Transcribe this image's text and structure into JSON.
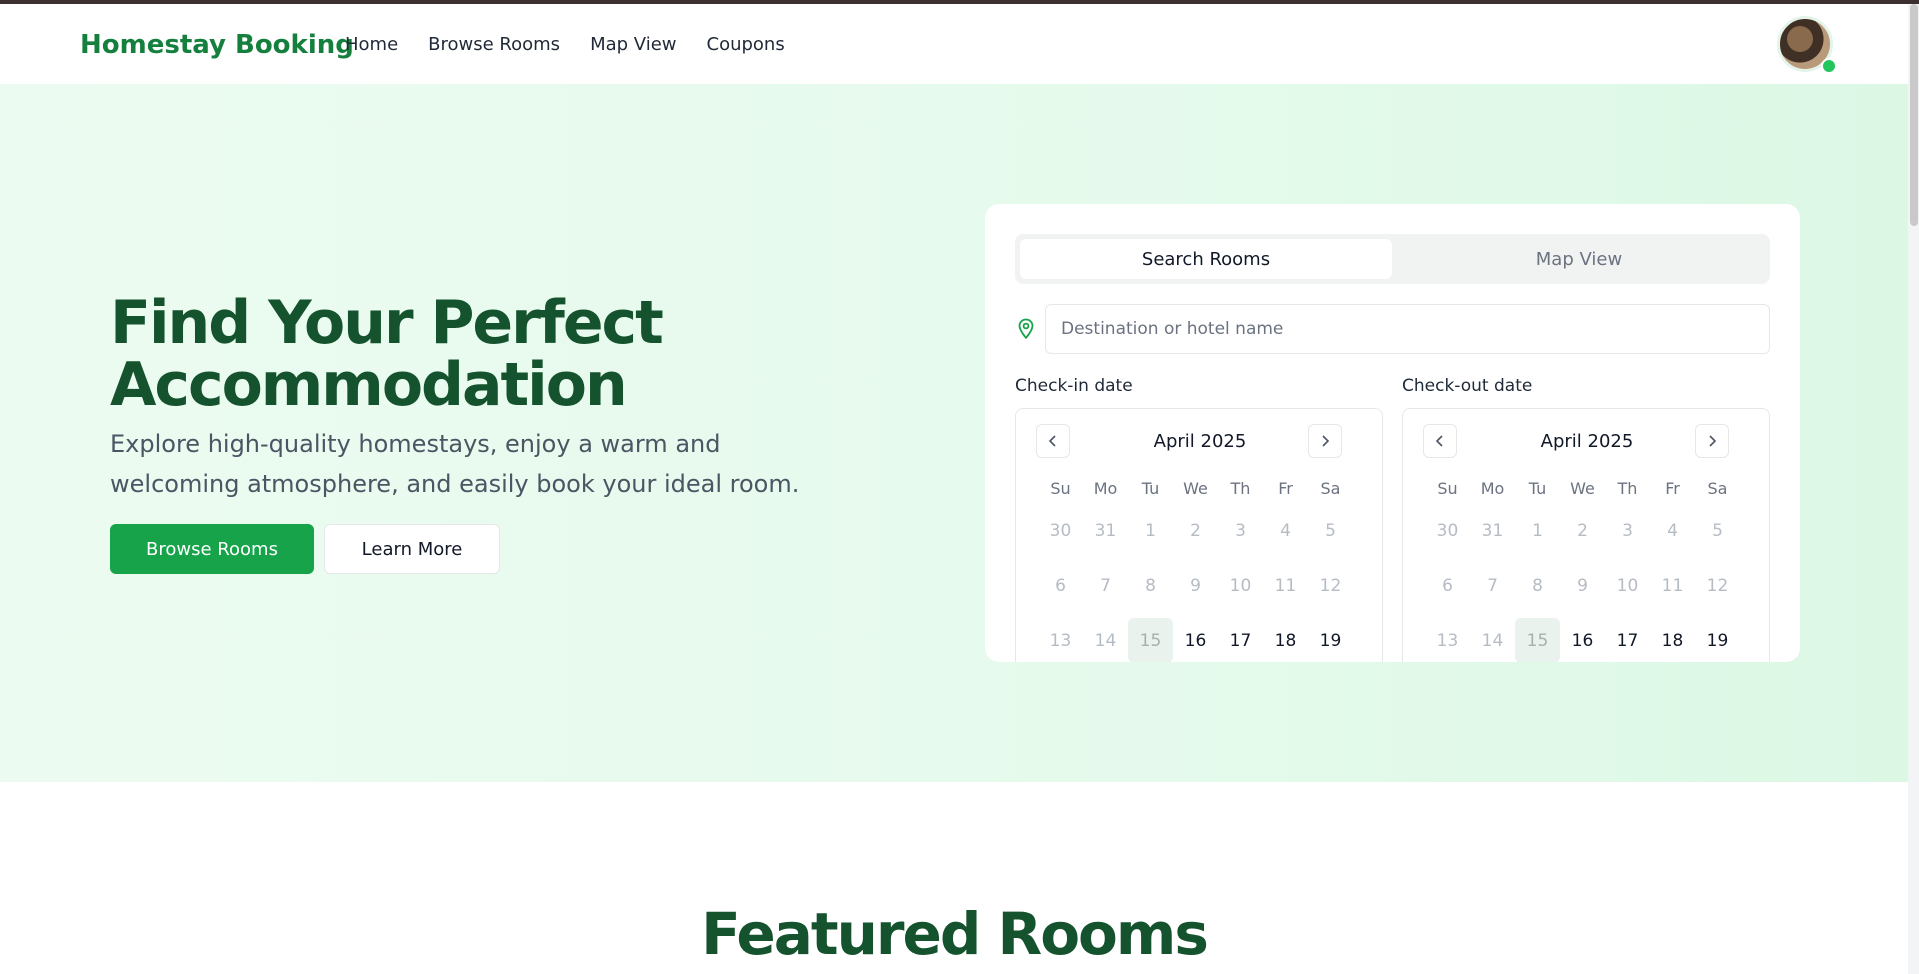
{
  "header": {
    "brand": "Homestay Booking",
    "nav": [
      "Home",
      "Browse Rooms",
      "Map View",
      "Coupons"
    ],
    "status_color": "#22c55e"
  },
  "hero": {
    "title_line1": "Find Your Perfect",
    "title_line2": "Accommodation",
    "subtitle": "Explore high-quality homestays, enjoy a warm and welcoming atmosphere, and easily book your ideal room.",
    "primary_button": "Browse Rooms",
    "secondary_button": "Learn More",
    "brand_color": "#16a34a"
  },
  "search": {
    "tabs": [
      "Search Rooms",
      "Map View"
    ],
    "active_tab": "Search Rooms",
    "destination_placeholder": "Destination or hotel name",
    "destination_value": "",
    "checkin_label": "Check-in date",
    "checkout_label": "Check-out date",
    "checkin_calendar": {
      "month": "April 2025",
      "weekdays": [
        "Su",
        "Mo",
        "Tu",
        "We",
        "Th",
        "Fr",
        "Sa"
      ],
      "days": [
        [
          "30",
          "31",
          "1",
          "2",
          "3",
          "4",
          "5"
        ],
        [
          "6",
          "7",
          "8",
          "9",
          "10",
          "11",
          "12"
        ],
        [
          "13",
          "14",
          "15",
          "16",
          "17",
          "18",
          "19"
        ]
      ],
      "today": "15",
      "first_selectable": "16"
    },
    "checkout_calendar": {
      "month": "April 2025",
      "weekdays": [
        "Su",
        "Mo",
        "Tu",
        "We",
        "Th",
        "Fr",
        "Sa"
      ],
      "days": [
        [
          "30",
          "31",
          "1",
          "2",
          "3",
          "4",
          "5"
        ],
        [
          "6",
          "7",
          "8",
          "9",
          "10",
          "11",
          "12"
        ],
        [
          "13",
          "14",
          "15",
          "16",
          "17",
          "18",
          "19"
        ]
      ],
      "today": "15",
      "first_selectable": "16"
    }
  },
  "featured": {
    "title": "Featured Rooms"
  }
}
